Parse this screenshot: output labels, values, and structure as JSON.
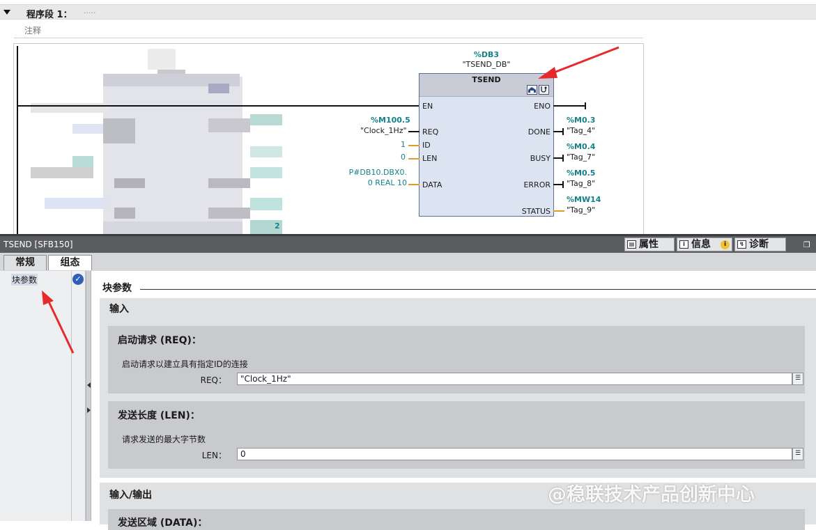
{
  "editor": {
    "segment_title": "程序段 1：",
    "segment_dots": ".....",
    "comment_placeholder": "注释",
    "block": {
      "db_address": "%DB3",
      "db_name": "\"TSEND_DB\"",
      "type_name": "TSEND",
      "inputs": [
        {
          "pin": "EN"
        },
        {
          "pin": "REQ",
          "address": "%M100.5",
          "tag": "\"Clock_1Hz\""
        },
        {
          "pin": "ID",
          "constant": "1"
        },
        {
          "pin": "LEN",
          "constant": "0"
        },
        {
          "pin": "DATA",
          "constant_line1": "P#DB10.DBX0.",
          "constant_line2": "0 REAL 10"
        }
      ],
      "outputs": [
        {
          "pin": "ENO"
        },
        {
          "pin": "DONE",
          "address": "%M0.3",
          "tag": "\"Tag_4\""
        },
        {
          "pin": "BUSY",
          "address": "%M0.4",
          "tag": "\"Tag_7\""
        },
        {
          "pin": "ERROR",
          "address": "%M0.5",
          "tag": "\"Tag_8\""
        },
        {
          "pin": "STATUS",
          "address": "%MW14",
          "tag": "\"Tag_9\""
        }
      ],
      "fragment_text": "2"
    }
  },
  "inspector": {
    "title": "TSEND [SFB150]",
    "right_tabs": {
      "properties": "属性",
      "info": "信息",
      "diagnostics": "诊断"
    },
    "tabs": {
      "general": "常规",
      "config": "组态"
    },
    "nav": {
      "item": "块参数"
    },
    "section_title": "块参数",
    "input_group": {
      "title": "输入",
      "req": {
        "title": "启动请求 (REQ)：",
        "desc": "启动请求以建立具有指定ID的连接",
        "label": "REQ：",
        "value": "\"Clock_1Hz\""
      },
      "len": {
        "title": "发送长度 (LEN)：",
        "desc": "请求发送的最大字节数",
        "label": "LEN：",
        "value": "0"
      }
    },
    "inout_group": {
      "title": "输入/输出",
      "data": {
        "title": "发送区域 (DATA)："
      }
    }
  },
  "watermark": "@稳联技术产品创新中心",
  "colors": {
    "address_teal": "#16818a",
    "block_fill": "#dce4f2",
    "wire_orange": "#e39a2a",
    "annotation_red": "#e8292b"
  }
}
